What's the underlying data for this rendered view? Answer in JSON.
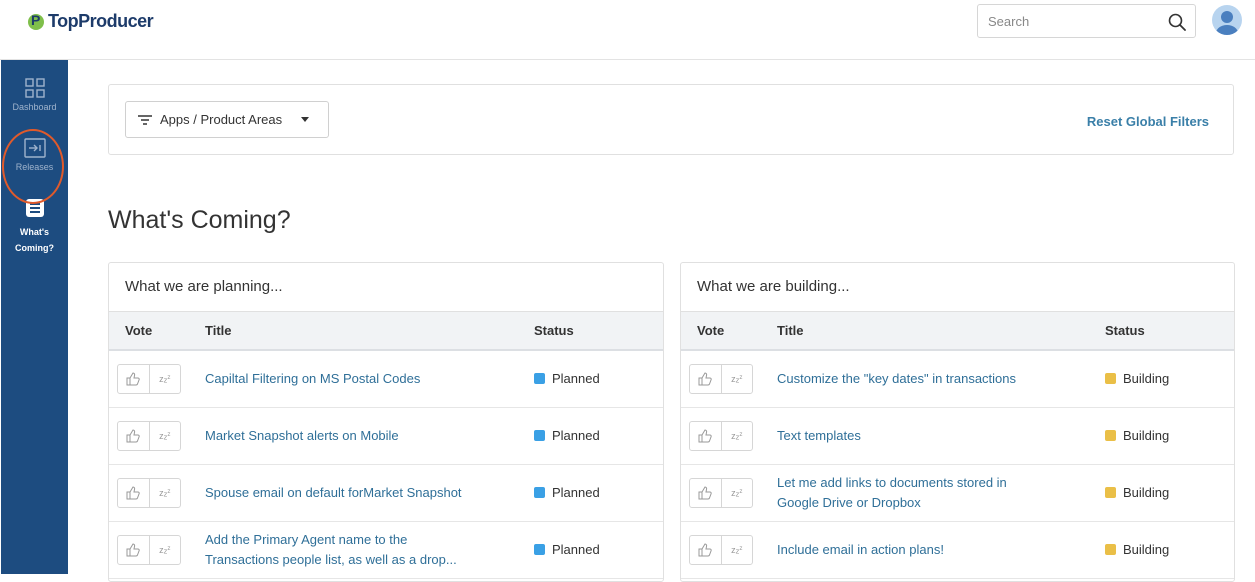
{
  "app": {
    "logo": "TopProducer"
  },
  "search": {
    "placeholder": "Search"
  },
  "sidebar": {
    "items": [
      {
        "label": "Dashboard",
        "icon": "grid-icon"
      },
      {
        "label": "Releases",
        "icon": "release-icon"
      },
      {
        "label_line1": "What's",
        "label_line2": "Coming?",
        "icon": "list-icon"
      }
    ]
  },
  "filters": {
    "dropdown_label": "Apps / Product Areas",
    "reset_label": "Reset Global Filters"
  },
  "page": {
    "title": "What's Coming?"
  },
  "colors": {
    "planned": "#3aa0e5",
    "building": "#eabf47",
    "link": "#2f6f98",
    "sidebar": "#1d4c80"
  },
  "planning": {
    "title": "What we are planning...",
    "headers": {
      "vote": "Vote",
      "title": "Title",
      "status": "Status"
    },
    "rows": [
      {
        "title": "Capiltal Filtering on MS Postal Codes",
        "status": "Planned"
      },
      {
        "title": "Market Snapshot alerts on Mobile",
        "status": "Planned"
      },
      {
        "title": "Spouse email on default forMarket Snapshot",
        "status": "Planned"
      },
      {
        "title_line1": "Add the Primary Agent name to the",
        "title_line2": "Transactions people list, as well as a drop...",
        "status": "Planned"
      }
    ]
  },
  "building": {
    "title": "What we are building...",
    "headers": {
      "vote": "Vote",
      "title": "Title",
      "status": "Status"
    },
    "rows": [
      {
        "title": "Customize the \"key dates\" in transactions",
        "status": "Building"
      },
      {
        "title": "Text templates",
        "status": "Building"
      },
      {
        "title_line1": "Let me add links to documents stored in",
        "title_line2": "Google Drive or Dropbox",
        "status": "Building"
      },
      {
        "title": "Include email in action plans!",
        "status": "Building"
      }
    ]
  }
}
